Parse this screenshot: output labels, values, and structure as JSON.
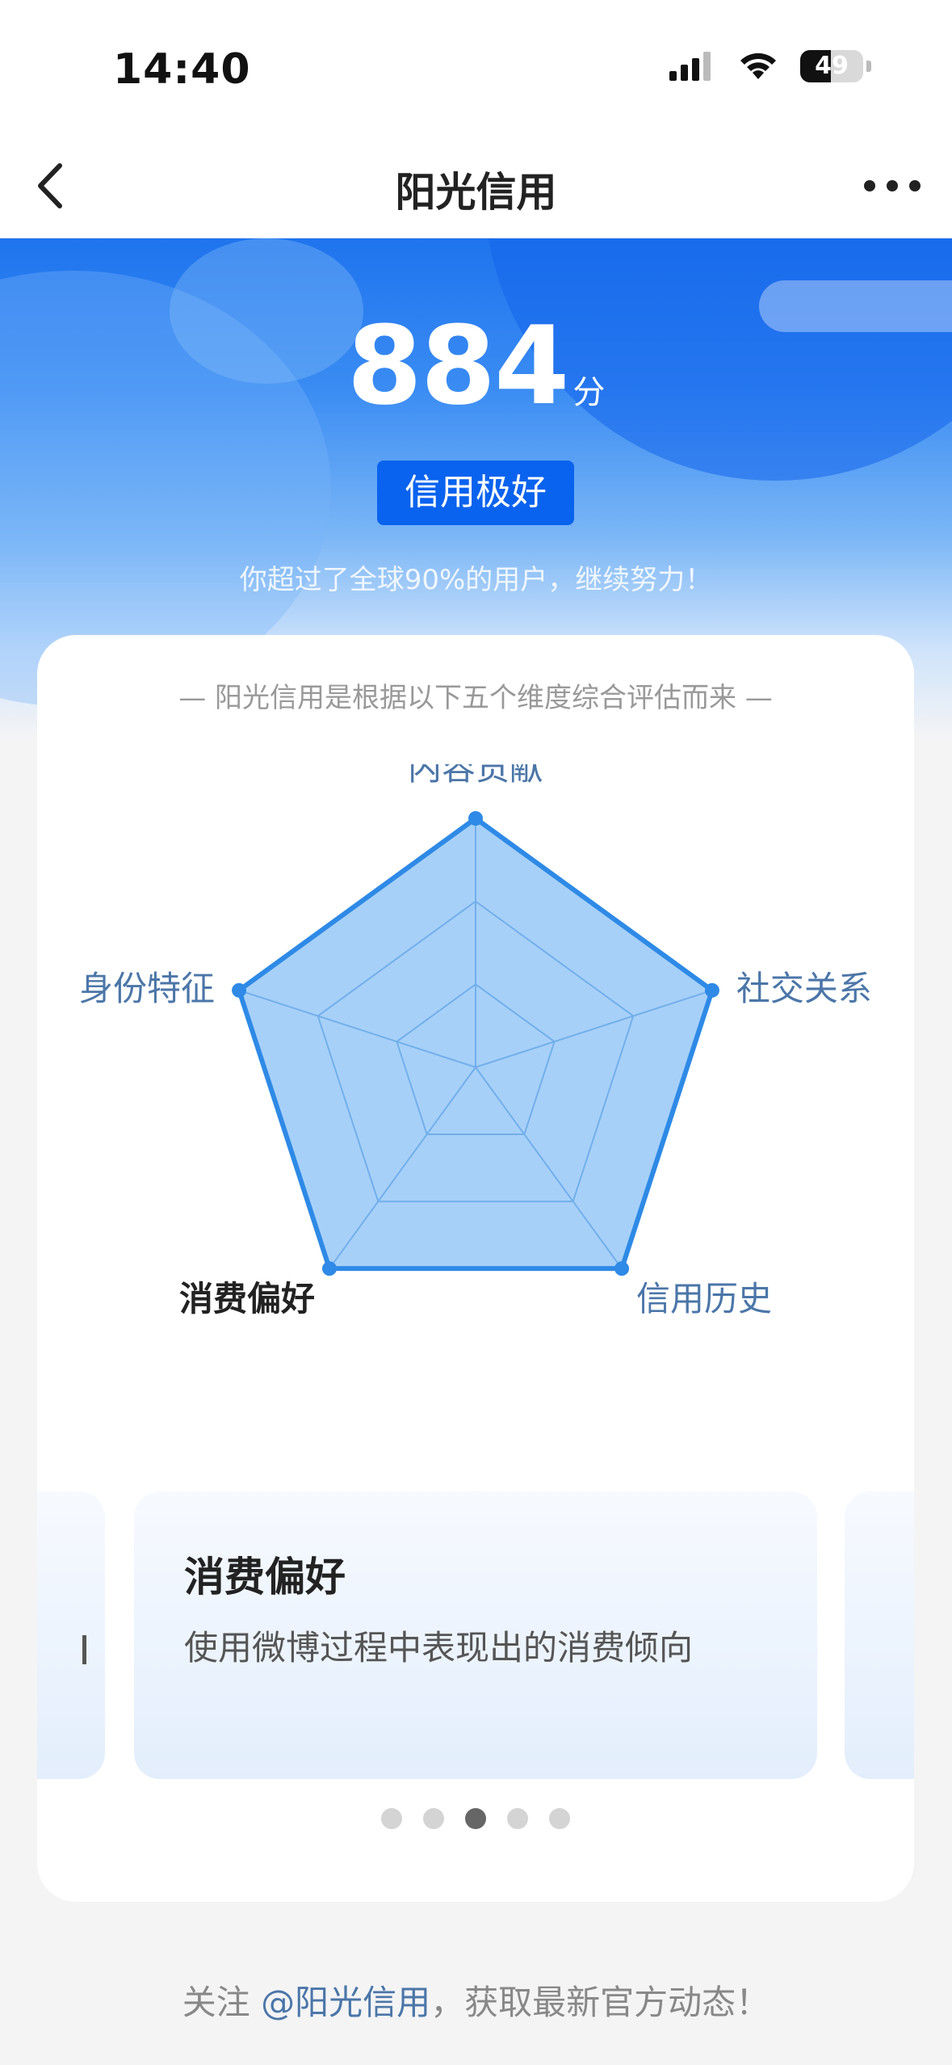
{
  "status_bar": {
    "time": "14:40",
    "battery": "49"
  },
  "nav": {
    "title": "阳光信用"
  },
  "hero": {
    "score": "884",
    "unit": "分",
    "level": "信用极好",
    "subtitle": "你超过了全球90%的用户，继续努力！"
  },
  "card": {
    "intro": "— 阳光信用是根据以下五个维度综合评估而来 —",
    "chart_data": {
      "type": "radar",
      "axes": [
        "内容贡献",
        "社交关系",
        "信用历史",
        "消费偏好",
        "身份特征"
      ],
      "values": [
        1.0,
        1.0,
        1.0,
        1.0,
        1.0
      ],
      "range": [
        0,
        1
      ],
      "grid_levels": 3,
      "selected_axis": "消费偏好"
    },
    "slides": [
      {
        "title": "消费偏好",
        "desc": "使用微博过程中表现出的消费倾向"
      }
    ],
    "dots": {
      "count": 5,
      "active_index": 2
    }
  },
  "footer": {
    "prefix": "关注 ",
    "link": "@阳光信用",
    "suffix": "，获取最新官方动态！"
  }
}
